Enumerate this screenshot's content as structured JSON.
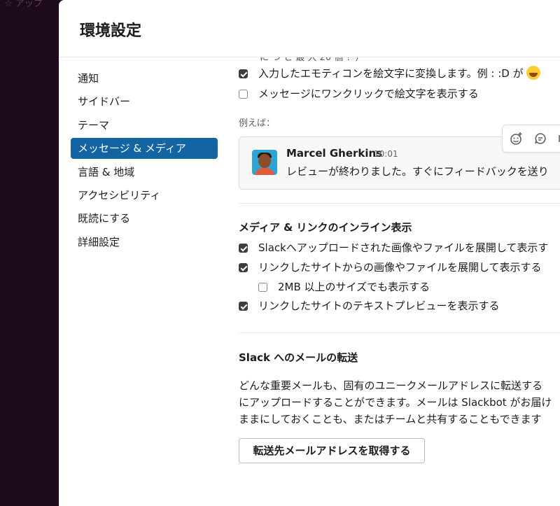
{
  "background": {
    "app_label": "アップ"
  },
  "modal": {
    "title": "環境設定"
  },
  "sidebar": {
    "items": [
      {
        "label": "通知",
        "active": false
      },
      {
        "label": "サイドバー",
        "active": false
      },
      {
        "label": "テーマ",
        "active": false
      },
      {
        "label": "メッセージ & メディア",
        "active": true
      },
      {
        "label": "言語 & 地域",
        "active": false
      },
      {
        "label": "アクセシビリティ",
        "active": false
      },
      {
        "label": "既読にする",
        "active": false
      },
      {
        "label": "詳細設定",
        "active": false
      }
    ]
  },
  "emoji": {
    "cut_text": "に つ と 最 大 20 個 ！）",
    "convert_label": "入力したエモティコンを絵文字に変換します。例 : :D が",
    "convert_checked": true,
    "one_click_label": "メッセージにワンクリックで絵文字を表示する",
    "one_click_checked": false
  },
  "example": {
    "label": "例えば：",
    "author": "Marcel Gherkins",
    "time": "10:01",
    "text": "レビューが終わりました。すぐにフィードバックを送り"
  },
  "media": {
    "title": "メディア & リンクのインライン表示",
    "options": [
      {
        "label": "Slackへアップロードされた画像やファイルを展開して表示す",
        "checked": true
      },
      {
        "label": "リンクしたサイトからの画像やファイルを展開して表示する",
        "checked": true
      },
      {
        "label": "2MB 以上のサイズでも表示する",
        "checked": false
      },
      {
        "label": "リンクしたサイトのテキストプレビューを表示する",
        "checked": true
      }
    ]
  },
  "forward": {
    "title": "Slack へのメールの転送",
    "lines": [
      "どんな重要メールも、固有のユニークメールアドレスに転送する",
      "にアップロードすることができます。メールは Slackbot がお届け",
      "ままにしておくことも、またはチームと共有することもできます"
    ],
    "button_label": "転送先メールアドレスを取得する"
  }
}
